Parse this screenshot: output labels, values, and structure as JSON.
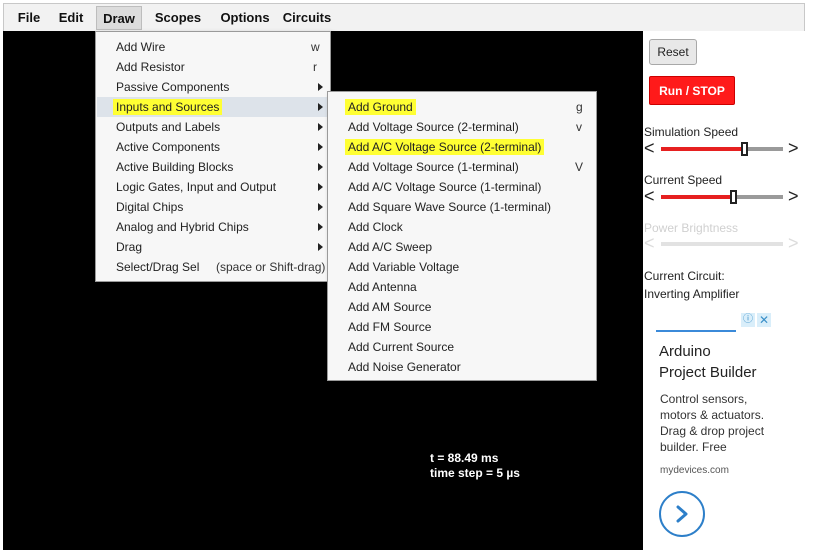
{
  "menubar": {
    "items": [
      "File",
      "Edit",
      "Draw",
      "Scopes",
      "Options",
      "Circuits"
    ]
  },
  "draw_menu": {
    "items": [
      {
        "label": "Add Wire",
        "shortcut": "w"
      },
      {
        "label": "Add Resistor",
        "shortcut": "r"
      },
      {
        "label": "Passive Components",
        "submenu": true
      },
      {
        "label": "Inputs and Sources",
        "submenu": true
      },
      {
        "label": "Outputs and Labels",
        "submenu": true
      },
      {
        "label": "Active Components",
        "submenu": true
      },
      {
        "label": "Active Building Blocks",
        "submenu": true
      },
      {
        "label": "Logic Gates, Input and Output",
        "submenu": true
      },
      {
        "label": "Digital Chips",
        "submenu": true
      },
      {
        "label": "Analog and Hybrid Chips",
        "submenu": true
      },
      {
        "label": "Drag",
        "submenu": true
      },
      {
        "label": "Select/Drag Sel",
        "shortcut": "(space or Shift-drag)"
      }
    ]
  },
  "inputs_submenu": {
    "items": [
      {
        "label": "Add Ground",
        "shortcut": "g"
      },
      {
        "label": "Add Voltage Source (2-terminal)",
        "shortcut": "v"
      },
      {
        "label": "Add A/C Voltage Source (2-terminal)",
        "shortcut": ""
      },
      {
        "label": "Add Voltage Source (1-terminal)",
        "shortcut": "V"
      },
      {
        "label": "Add A/C Voltage Source (1-terminal)",
        "shortcut": ""
      },
      {
        "label": "Add Square Wave Source (1-terminal)",
        "shortcut": ""
      },
      {
        "label": "Add Clock",
        "shortcut": ""
      },
      {
        "label": "Add A/C Sweep",
        "shortcut": ""
      },
      {
        "label": "Add Variable Voltage",
        "shortcut": ""
      },
      {
        "label": "Add Antenna",
        "shortcut": ""
      },
      {
        "label": "Add AM Source",
        "shortcut": ""
      },
      {
        "label": "Add FM Source",
        "shortcut": ""
      },
      {
        "label": "Add Current Source",
        "shortcut": ""
      },
      {
        "label": "Add Noise Generator",
        "shortcut": ""
      }
    ]
  },
  "canvas": {
    "time_text": "t = 88.49 ms",
    "timestep_text": "time step = 5 µs"
  },
  "panel": {
    "reset_label": "Reset",
    "run_label": "Run / STOP",
    "sim_speed_label": "Simulation Speed",
    "sim_speed_value": 0.68,
    "current_speed_label": "Current Speed",
    "current_speed_value": 0.59,
    "power_brightness_label": "Power Brightness",
    "power_brightness_value": 0.0,
    "current_circuit_label": "Current Circuit:",
    "current_circuit_name": "Inverting Amplifier"
  },
  "ad": {
    "title_line1": "Arduino",
    "title_line2": "Project Builder",
    "text_line1": "Control sensors,",
    "text_line2": "motors & actuators.",
    "text_line3": "Drag & drop project",
    "text_line4": "builder. Free",
    "domain": "mydevices.com",
    "info_glyph": "ⓘ",
    "close_glyph": "✕"
  },
  "colors": {
    "highlight": "#ffff33",
    "run_button": "#ff1a1a",
    "slider_fill": "#e62020",
    "canvas": "#000000"
  },
  "icons": {
    "submenu_arrow": "right-triangle-arrow-icon",
    "slider_left": "chevron-left-icon",
    "slider_right": "chevron-right-icon",
    "ad_next": "chevron-right-circle-icon"
  }
}
